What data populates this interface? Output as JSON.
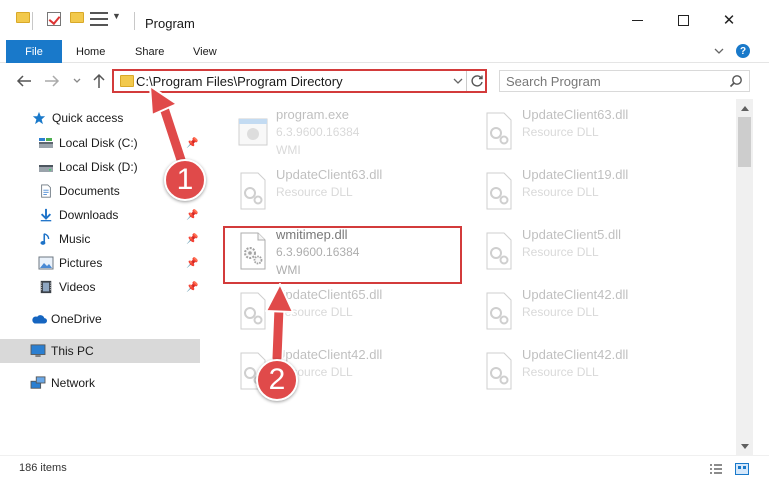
{
  "window": {
    "title": "Program",
    "minimize_icon": "minimize-icon",
    "maximize_icon": "maximize-icon",
    "close_label": "✕"
  },
  "ribbon": {
    "tabs": [
      {
        "label": "File",
        "active": true
      },
      {
        "label": "Home"
      },
      {
        "label": "Share"
      },
      {
        "label": "View"
      }
    ],
    "expand_icon": "chevron-down-icon",
    "help_label": "?"
  },
  "navigation": {
    "back_icon": "arrow-left-icon",
    "forward_icon": "arrow-right-icon",
    "recent_icon": "chevron-down-icon",
    "up_icon": "arrow-up-icon",
    "address": "C:\\Program Files\\Program Directory",
    "refresh_icon": "refresh-icon",
    "search_placeholder": "Search Program"
  },
  "sidebar": {
    "items": [
      {
        "label": "Quick access",
        "icon": "star-icon"
      },
      {
        "label": "Local Disk (C:)",
        "icon": "drive-icon",
        "pinned": true
      },
      {
        "label": "Local Disk (D:)",
        "icon": "drive-icon"
      },
      {
        "label": "Documents",
        "icon": "document-icon",
        "pinned": true
      },
      {
        "label": "Downloads",
        "icon": "download-icon",
        "pinned": true
      },
      {
        "label": "Music",
        "icon": "music-icon",
        "pinned": true
      },
      {
        "label": "Pictures",
        "icon": "picture-icon",
        "pinned": true
      },
      {
        "label": "Videos",
        "icon": "video-icon",
        "pinned": true
      },
      {
        "label": "OneDrive",
        "icon": "cloud-icon"
      },
      {
        "label": "This PC",
        "icon": "computer-icon",
        "selected": true
      },
      {
        "label": "Network",
        "icon": "network-icon"
      }
    ]
  },
  "files": [
    {
      "name": "program.exe",
      "type": "6.3.9600.16384",
      "desc": "WMI",
      "icon": "exe-icon",
      "faded": true
    },
    {
      "name": "UpdateClient63.dll",
      "type": "Resource DLL",
      "desc": "",
      "icon": "dll-icon",
      "faded": true
    },
    {
      "name": "UpdateClient63.dll",
      "type": "Resource DLL",
      "desc": "",
      "icon": "dll-icon",
      "faded": true
    },
    {
      "name": "UpdateClient19.dll",
      "type": "Resource DLL",
      "desc": "",
      "icon": "dll-icon",
      "faded": true
    },
    {
      "name": "wmitimep.dll",
      "type": "6.3.9600.16384",
      "desc": "WMI",
      "icon": "dll-icon",
      "faded": false
    },
    {
      "name": "UpdateClient5.dll",
      "type": "Resource DLL",
      "desc": "",
      "icon": "dll-icon",
      "faded": true
    },
    {
      "name": "UpdateClient65.dll",
      "type": "Resource DLL",
      "desc": "",
      "icon": "dll-icon",
      "faded": true
    },
    {
      "name": "UpdateClient42.dll",
      "type": "Resource DLL",
      "desc": "",
      "icon": "dll-icon",
      "faded": true
    },
    {
      "name": "UpdateClient42.dll",
      "type": "Resource DLL",
      "desc": "",
      "icon": "dll-icon",
      "faded": true
    },
    {
      "name": "UpdateClient42.dll",
      "type": "Resource DLL",
      "desc": "",
      "icon": "dll-icon",
      "faded": true
    }
  ],
  "status": {
    "item_count": "186 items"
  },
  "annotations": {
    "step1": "1",
    "step2": "2",
    "color": "#e04a4a"
  },
  "colors": {
    "accent": "#1979ca",
    "highlight": "#d33b3b",
    "selected_bg": "#d9d9d9"
  }
}
